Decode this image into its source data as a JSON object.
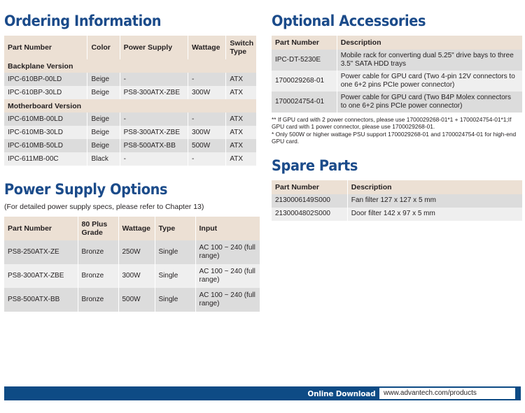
{
  "sections": {
    "ordering": {
      "title": "Ordering Information",
      "headers": [
        "Part Number",
        "Color",
        "Power Supply",
        "Wattage",
        "Switch Type"
      ],
      "groups": [
        {
          "label": "Backplane Version",
          "rows": [
            [
              "IPC-610BP-00LD",
              "Beige",
              "-",
              "-",
              "ATX"
            ],
            [
              "IPC-610BP-30LD",
              "Beige",
              "PS8-300ATX-ZBE",
              "300W",
              "ATX"
            ]
          ]
        },
        {
          "label": "Motherboard Version",
          "rows": [
            [
              "IPC-610MB-00LD",
              "Beige",
              "-",
              "-",
              "ATX"
            ],
            [
              "IPC-610MB-30LD",
              "Beige",
              "PS8-300ATX-ZBE",
              "300W",
              "ATX"
            ],
            [
              "IPC-610MB-50LD",
              "Beige",
              "PS8-500ATX-BB",
              "500W",
              "ATX"
            ],
            [
              "IPC-611MB-00C",
              "Black",
              "-",
              "-",
              "ATX"
            ]
          ]
        }
      ]
    },
    "power_supply": {
      "title": "Power Supply Options",
      "note": "(For detailed power supply specs, please refer to Chapter 13)",
      "headers": [
        "Part Number",
        "80 Plus Grade",
        "Wattage",
        "Type",
        "Input"
      ],
      "rows": [
        [
          "PS8-250ATX-ZE",
          "Bronze",
          "250W",
          "Single",
          "AC 100 ~ 240 (full range)"
        ],
        [
          "PS8-300ATX-ZBE",
          "Bronze",
          "300W",
          "Single",
          "AC 100 ~ 240 (full range)"
        ],
        [
          "PS8-500ATX-BB",
          "Bronze",
          "500W",
          "Single",
          "AC 100 ~ 240 (full range)"
        ]
      ]
    },
    "accessories": {
      "title": "Optional Accessories",
      "headers": [
        "Part Number",
        "Description"
      ],
      "rows": [
        [
          "IPC-DT-5230E",
          "Mobile rack for converting dual 5.25\" drive bays to three 3.5\" SATA HDD trays"
        ],
        [
          "1700029268-01",
          "Power cable for GPU card (Two 4-pin 12V connectors to one 6+2 pins PCIe power connector)"
        ],
        [
          "1700024754-01",
          "Power cable for GPU card (Two B4P Molex connectors to one 6+2 pins PCIe power connector)"
        ]
      ],
      "footnotes": [
        "** If GPU card with 2 power connectors, please use 1700029268-01*1 + 1700024754-01*1;If GPU card with 1 power connector, please use 1700029268-01.",
        "* Only 500W or higher wattage PSU support 1700029268-01 and 1700024754-01 for high-end GPU card."
      ]
    },
    "spare_parts": {
      "title": "Spare Parts",
      "headers": [
        "Part Number",
        "Description"
      ],
      "rows": [
        [
          "2130006149S000",
          "Fan filter 127 x 127 x 5 mm"
        ],
        [
          "2130004802S000",
          "Door filter 142 x 97 x 5 mm"
        ]
      ]
    }
  },
  "footer": {
    "label": "Online Download",
    "url": "www.advantech.com/products"
  },
  "colors": {
    "heading_blue": "#1b4b8a",
    "footer_blue": "#0e4b85",
    "table_header_beige": "#ece0d4",
    "row_dark": "#dcdcdc",
    "row_light": "#efefef"
  }
}
